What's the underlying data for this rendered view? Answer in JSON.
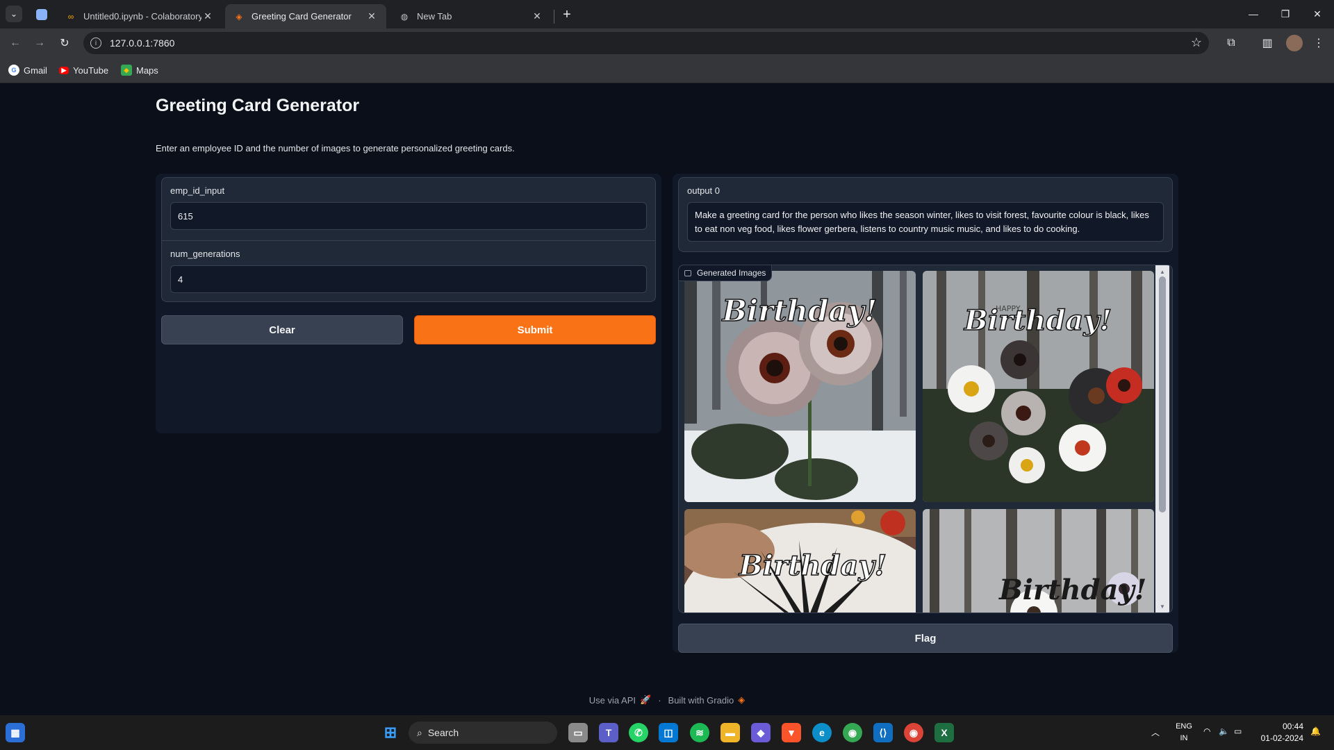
{
  "browser": {
    "tabs": [
      {
        "title": "Untitled0.ipynb - Colaboratory",
        "active": false
      },
      {
        "title": "Greeting Card Generator",
        "active": true
      },
      {
        "title": "New Tab",
        "active": false
      }
    ],
    "url": "127.0.0.1:7860",
    "bookmarks": [
      "Gmail",
      "YouTube",
      "Maps"
    ]
  },
  "app": {
    "title": "Greeting Card Generator",
    "description": "Enter an employee ID and the number of images to generate personalized greeting cards.",
    "inputs": {
      "emp_id_label": "emp_id_input",
      "emp_id_value": "615",
      "num_generations_label": "num_generations",
      "num_generations_value": "4"
    },
    "buttons": {
      "clear": "Clear",
      "submit": "Submit",
      "flag": "Flag"
    },
    "output": {
      "label": "output 0",
      "text": "Make a greeting card for the person who likes the season winter, likes to visit forest, favourite colour is black, likes to eat non veg food, likes flower gerbera, listens to country music music, and likes to do cooking."
    },
    "gallery": {
      "label": "Generated Images",
      "images": [
        {
          "caption": "Birthday!"
        },
        {
          "caption": "Birthday!",
          "subcaption": "HAPPY"
        },
        {
          "caption": "Birthday!"
        },
        {
          "caption": "Birthday!"
        }
      ]
    },
    "footer": {
      "api": "Use via API",
      "built": "Built with Gradio"
    }
  },
  "taskbar": {
    "search": "Search",
    "lang_top": "ENG",
    "lang_bottom": "IN",
    "time": "00:44",
    "date": "01-02-2024"
  },
  "colors": {
    "background": "#0b0f19",
    "panel": "#111827",
    "block": "#1f2937",
    "accent": "#f97316"
  }
}
